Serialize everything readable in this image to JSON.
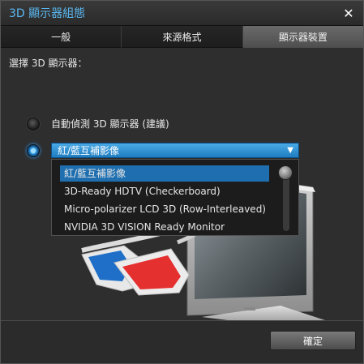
{
  "window": {
    "title": "3D 顯示器組態"
  },
  "tabs": [
    {
      "label": "一般"
    },
    {
      "label": "來源格式"
    },
    {
      "label": "顯示器裝置"
    }
  ],
  "panel": {
    "section_label": "選擇 3D 顯示器：",
    "auto_detect_label": "自動偵測 3D 顯示器 (建議)",
    "selected_value": "紅/藍互補影像",
    "options": [
      "紅/藍互補影像",
      "3D-Ready HDTV (Checkerboard)",
      "Micro-polarizer LCD 3D (Row-Interleaved)",
      "NVIDIA 3D VISION Ready Monitor"
    ]
  },
  "footer": {
    "ok_label": "確定"
  },
  "colors": {
    "accent": "#1f7dc0",
    "title": "#5ab8f0"
  }
}
